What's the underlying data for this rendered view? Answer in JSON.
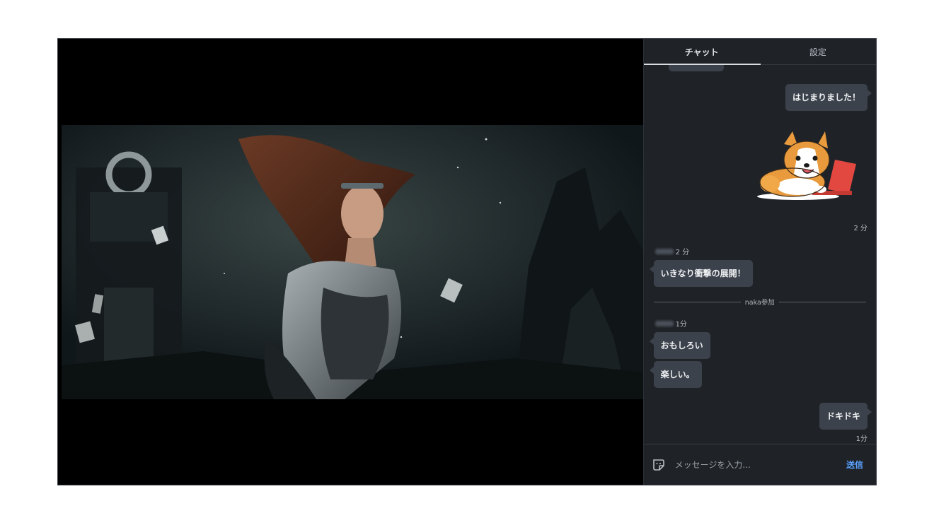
{
  "tabs": {
    "chat": "チャット",
    "settings": "設定"
  },
  "messages": {
    "msg1": "はじまりました！",
    "sticker_time": "2 分",
    "msg2_time": "2 分",
    "msg2": "いきなり衝撃の展開！",
    "join_notice": "naka参加",
    "msg3_time": "1分",
    "msg3a": "おもしろい",
    "msg3b": "楽しい。",
    "msg4": "ドキドキ",
    "msg4_time": "1分"
  },
  "input": {
    "placeholder": "メッセージを入力...",
    "send_label": "送信"
  },
  "colors": {
    "panel_bg": "#1f2328",
    "bubble_bg": "#3c424b",
    "accent": "#5aa2ff"
  }
}
